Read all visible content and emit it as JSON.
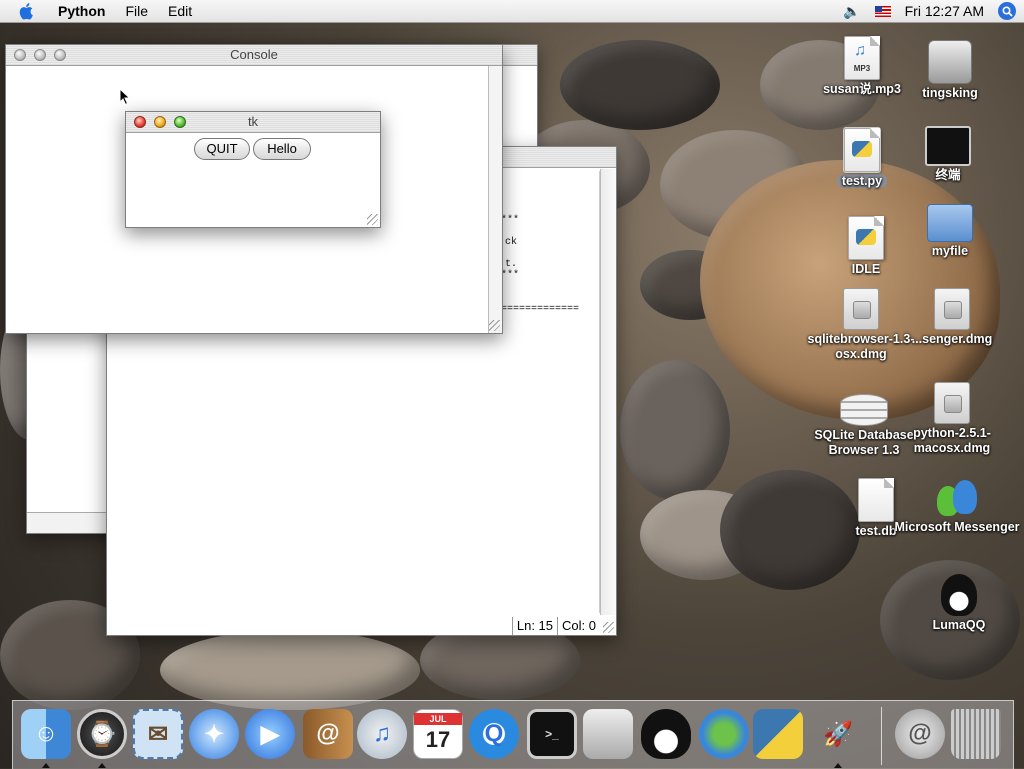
{
  "menubar": {
    "app_name": "Python",
    "menus": [
      "File",
      "Edit"
    ],
    "clock": "Fri 12:27 AM"
  },
  "console_window": {
    "title": "Console"
  },
  "tk_window": {
    "title": "tk",
    "buttons": {
      "quit": "QUIT",
      "hello": "Hello"
    }
  },
  "editor_window": {
    "text_lines": [
      "***",
      "ck",
      "t.",
      "***",
      "============="
    ],
    "status": {
      "line": "Ln: 15",
      "col": "Col: 0"
    }
  },
  "desktop_icons": [
    {
      "label": "susan说.mp3",
      "badge": "MP3"
    },
    {
      "label": "tingsking"
    },
    {
      "label": "test.py"
    },
    {
      "label": "终端"
    },
    {
      "label": "IDLE"
    },
    {
      "label": "myfile"
    },
    {
      "label": "sqlitebrowser-1.3-osx.dmg"
    },
    {
      "label": "...senger.dmg"
    },
    {
      "label": "SQLite Database Browser 1.3"
    },
    {
      "label": "python-2.5.1-macosx.dmg"
    },
    {
      "label": "test.db"
    },
    {
      "label": "Microsoft Messenger"
    },
    {
      "label": "LumaQQ"
    }
  ],
  "dock": {
    "calendar_month": "JUL",
    "calendar_day": "17",
    "items": [
      "finder",
      "dashboard",
      "mail",
      "safari",
      "ichat",
      "address-book",
      "itunes",
      "ical",
      "quicktime",
      "terminal",
      "system-preferences",
      "lumaqq",
      "messenger",
      "python-launcher",
      "rocket",
      "email-stamp",
      "trash"
    ]
  },
  "colors": {
    "desktop": "#4c4439",
    "accent": "#2a6fdb"
  }
}
